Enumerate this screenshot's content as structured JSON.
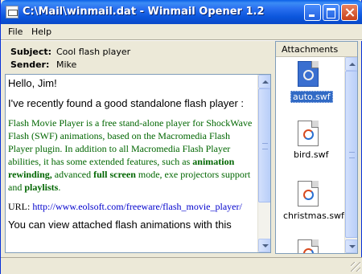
{
  "window": {
    "title": "C:\\Mail\\winmail.dat - Winmail Opener 1.2",
    "app_icon": "document-icon"
  },
  "menu": {
    "items": [
      {
        "label": "File"
      },
      {
        "label": "Help"
      }
    ]
  },
  "header": {
    "subject_label": "Subject:",
    "subject_value": "Cool flash player",
    "sender_label": "Sender:",
    "sender_value": "Mike"
  },
  "message": {
    "greeting": "Hello, Jim!",
    "intro": "I've recently found a good standalone flash player :",
    "desc_part1": "Flash Movie Player is a free stand-alone player for ShockWave Flash (SWF) animations, based on the Macromedia Flash Player plugin. In addition to all Macromedia Flash Player abilities, it has some extended features, such as ",
    "desc_bold1": "animation rewinding,",
    "desc_part2": " advanced ",
    "desc_bold2": "full screen",
    "desc_part3": " mode, exe projectors support and ",
    "desc_bold3": "playlists",
    "desc_part4": ".",
    "url_label": "URL: ",
    "url": "http://www.eolsoft.com/freeware/flash_movie_player/",
    "closing": "You can view attached flash animations with this"
  },
  "attachments": {
    "header": "Attachments",
    "items": [
      {
        "name": "auto.swf",
        "selected": true,
        "icon": "flash-file-icon"
      },
      {
        "name": "bird.swf",
        "selected": false,
        "icon": "flash-file-icon"
      },
      {
        "name": "christmas.swf",
        "selected": false,
        "icon": "flash-file-icon"
      },
      {
        "name": "",
        "selected": false,
        "icon": "flash-file-icon"
      }
    ]
  },
  "colors": {
    "titlebar": "#0a5fe8",
    "description_text": "#006600",
    "link": "#0000cc",
    "selection": "#316ac5"
  }
}
